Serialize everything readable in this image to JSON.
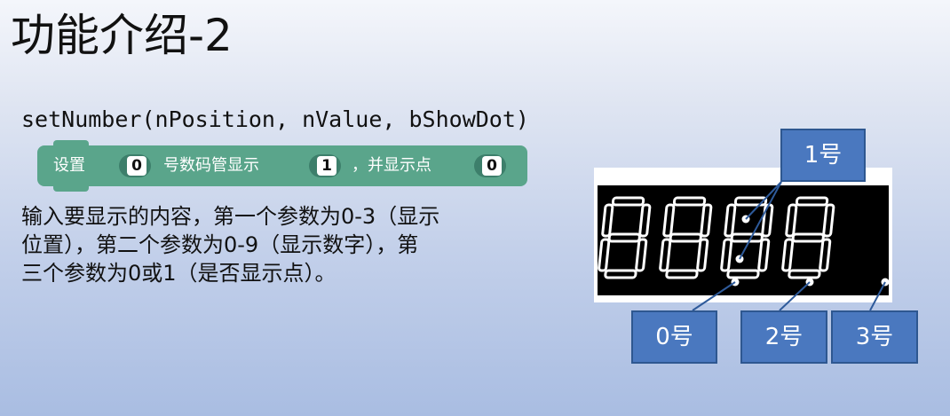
{
  "title": "功能介绍-2",
  "function_signature": "setNumber(nPosition, nValue, bShowDot)",
  "block": {
    "label_set": "设置",
    "slot1_value": "0",
    "label_digit_display": "号数码管显示",
    "slot2_value": "1",
    "label_show_dot": "，并显示点",
    "slot3_value": "0",
    "color": "#5aa58b"
  },
  "description": {
    "line1": "输入要显示的内容，第一个参数为0-3（显示",
    "line2": "位置），第二个参数为0-9（显示数字），第",
    "line3": "三个参数为0或1（是否显示点）。"
  },
  "display": {
    "digits": [
      "8",
      "8",
      "8",
      "8"
    ],
    "segment_color": "#ffffff",
    "background": "#000000"
  },
  "labels": {
    "pos0": "0号",
    "pos1": "1号",
    "pos2": "2号",
    "pos3": "3号",
    "box_color": "#4a78bf"
  }
}
